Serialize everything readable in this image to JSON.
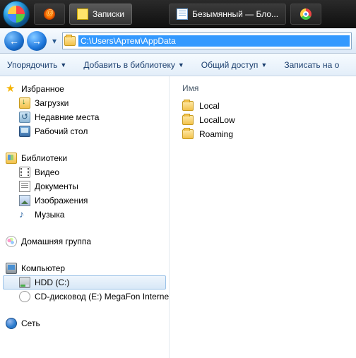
{
  "taskbar": {
    "items": [
      {
        "label": "Записки"
      },
      {
        "label": "Безымянный — Бло..."
      }
    ]
  },
  "address": {
    "path": "C:\\Users\\Артем\\AppData"
  },
  "toolbar": {
    "organize": "Упорядочить",
    "addlib": "Добавить в библиотеку",
    "share": "Общий доступ",
    "burn": "Записать на о"
  },
  "nav": {
    "favorites": {
      "label": "Избранное",
      "items": [
        "Загрузки",
        "Недавние места",
        "Рабочий стол"
      ]
    },
    "libraries": {
      "label": "Библиотеки",
      "items": [
        "Видео",
        "Документы",
        "Изображения",
        "Музыка"
      ]
    },
    "homegroup": {
      "label": "Домашняя группа"
    },
    "computer": {
      "label": "Компьютер",
      "items": [
        "HDD (C:)",
        "CD-дисковод (E:) MegaFon Internet"
      ]
    },
    "network": {
      "label": "Сеть"
    }
  },
  "content": {
    "column": "Имя",
    "folders": [
      "Local",
      "LocalLow",
      "Roaming"
    ]
  }
}
